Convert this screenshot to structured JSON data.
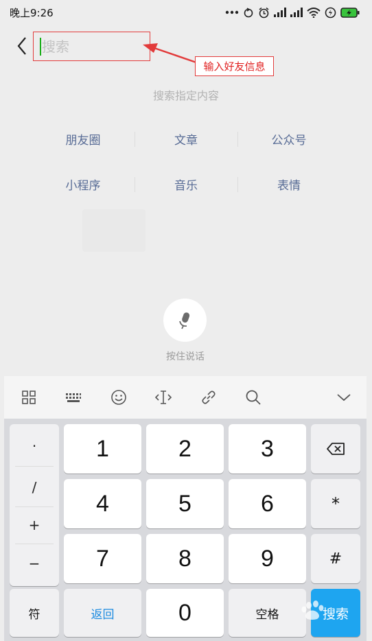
{
  "status_bar": {
    "time": "晚上9:26"
  },
  "search": {
    "placeholder": "搜索",
    "value": ""
  },
  "annotation": {
    "label": "输入好友信息"
  },
  "hint": {
    "title": "搜索指定内容"
  },
  "categories": [
    [
      "朋友圈",
      "文章",
      "公众号"
    ],
    [
      "小程序",
      "音乐",
      "表情"
    ]
  ],
  "voice": {
    "label": "按住说话"
  },
  "keyboard": {
    "left_symbols": [
      "·",
      "/",
      "+",
      "−"
    ],
    "numbers": [
      "1",
      "2",
      "3",
      "4",
      "5",
      "6",
      "7",
      "8",
      "9",
      "0"
    ],
    "right_keys": {
      "star": "*",
      "hash": "#"
    },
    "symbol_key": "符",
    "return_key": "返回",
    "space_key": "空格",
    "search_key": "搜索"
  },
  "colors": {
    "link": "#576b95",
    "annotation": "#e02020",
    "caret": "#1aad19",
    "search_key": "#1ea5f0"
  },
  "icons": {
    "toolbar": [
      "grid-icon",
      "keyboard-icon",
      "emoji-icon",
      "cursor-icon",
      "link-icon",
      "search-icon",
      "collapse-icon"
    ]
  }
}
